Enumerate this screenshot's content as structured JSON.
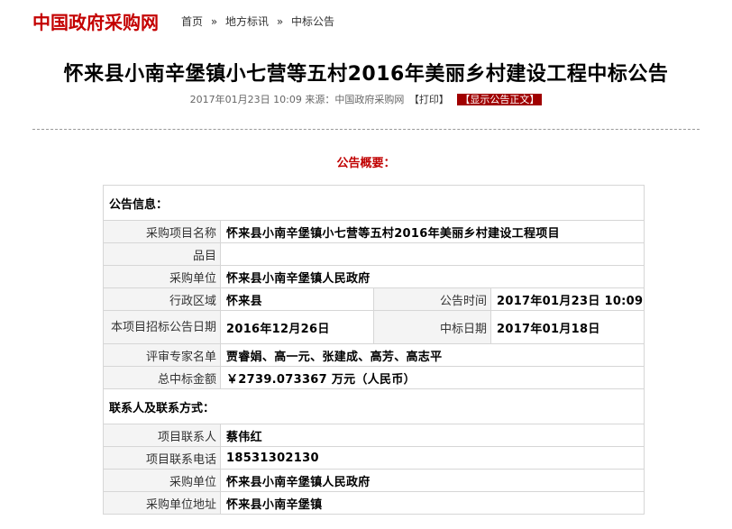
{
  "site": {
    "logo_text": "中国政府采购网"
  },
  "breadcrumb": {
    "items": [
      "首页",
      "地方标讯",
      "中标公告"
    ],
    "separator": "»"
  },
  "article": {
    "title": "怀来县小南辛堡镇小七营等五村2016年美丽乡村建设工程中标公告",
    "date_time": "2017年01月23日 10:09",
    "source_label": "来源：中国政府采购网",
    "print_label": "【打印】",
    "show_doc_label": "【显示公告正文】"
  },
  "summary_heading": "公告概要：",
  "info_section": {
    "heading": "公告信息：",
    "project_name_label": "采购项目名称",
    "project_name": "怀来县小南辛堡镇小七营等五村2016年美丽乡村建设工程项目",
    "item_label": "品目",
    "item": "",
    "purchaser_label": "采购单位",
    "purchaser": "怀来县小南辛堡镇人民政府",
    "region_label": "行政区域",
    "region": "怀来县",
    "announce_time_label": "公告时间",
    "announce_time": "2017年01月23日  10:09",
    "tender_date_label": "本项目招标公告日期",
    "tender_date": "2016年12月26日",
    "award_date_label": "中标日期",
    "award_date": "2017年01月18日",
    "experts_label": "评审专家名单",
    "experts": "贾睿娟、高一元、张建成、高芳、高志平",
    "amount_label": "总中标金额",
    "amount": "￥2739.073367 万元（人民币）"
  },
  "contact_section": {
    "heading": "联系人及联系方式：",
    "contact_label": "项目联系人",
    "contact": "蔡伟红",
    "phone_label": "项目联系电话",
    "phone": "18531302130",
    "purchaser_label": "采购单位",
    "purchaser": "怀来县小南辛堡镇人民政府",
    "address_label": "采购单位地址",
    "address": "怀来县小南辛堡镇"
  },
  "colors": {
    "brand_red": "#c40000",
    "summary_red": "#c00000",
    "button_bg": "#a00000",
    "label_bg": "#f4f4f4",
    "border": "#d6d6d6"
  }
}
